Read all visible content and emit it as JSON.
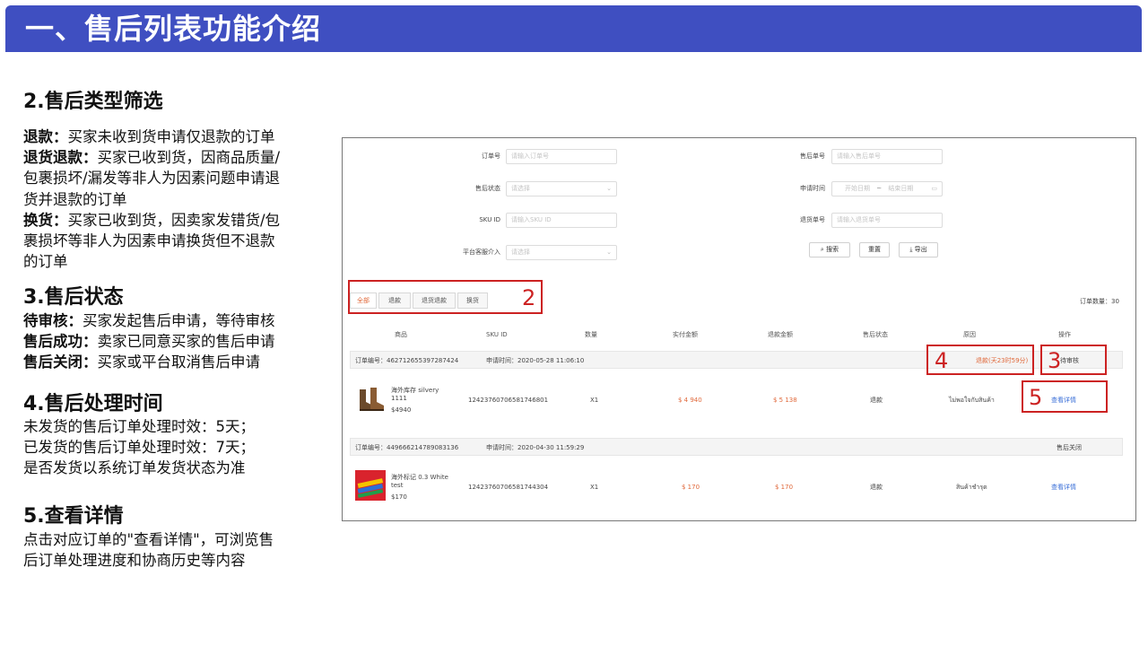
{
  "title": "一、售后列表功能介绍",
  "sections": {
    "s2": {
      "heading": "2.售后类型筛选",
      "items": [
        {
          "key": "退款：",
          "text": [
            "买家未收到货申请仅退款的订单"
          ]
        },
        {
          "key": "退货退款：",
          "text": [
            "买家已收到货，因商品质量/",
            "包裹损坏/漏发等非人为因素问题申请退",
            "货并退款的订单"
          ]
        },
        {
          "key": "换货：",
          "text": [
            "买家已收到货，因卖家发错货/包",
            "裹损坏等非人为因素申请换货但不退款",
            "的订单"
          ]
        }
      ]
    },
    "s3": {
      "heading": "3.售后状态",
      "items": [
        {
          "key": "待审核：",
          "text": "买家发起售后申请，等待审核"
        },
        {
          "key": "售后成功：",
          "text": "卖家已同意买家的售后申请"
        },
        {
          "key": "售后关闭：",
          "text": "买家或平台取消售后申请"
        }
      ]
    },
    "s4": {
      "heading": "4.售后处理时间",
      "lines": [
        "未发货的售后订单处理时效：5天；",
        "已发货的售后订单处理时效：7天；",
        "是否发货以系统订单发货状态为准"
      ]
    },
    "s5": {
      "heading": "5.查看详情",
      "lines": [
        "点击对应订单的\"查看详情\"，可浏览售",
        "后订单处理进度和协商历史等内容"
      ]
    }
  },
  "screenshot": {
    "filters": {
      "order_no": {
        "label": "订单号",
        "placeholder": "请输入订单号"
      },
      "after_sale_no": {
        "label": "售后单号",
        "placeholder": "请输入售后单号"
      },
      "status": {
        "label": "售后状态",
        "placeholder": "请选择"
      },
      "apply_time": {
        "label": "申请时间",
        "start": "开始日期",
        "sep": "~",
        "end": "结束日期"
      },
      "sku": {
        "label": "SKU ID",
        "placeholder": "请输入SKU ID"
      },
      "return_no": {
        "label": "退货单号",
        "placeholder": "请输入退货单号"
      },
      "platform": {
        "label": "平台客服介入",
        "placeholder": "请选择"
      },
      "search_label": "搜索",
      "reset_label": "重置",
      "export_label": "导出"
    },
    "tabs": [
      "全部",
      "退款",
      "退货退款",
      "换货"
    ],
    "order_count": "订单数量：30",
    "columns": [
      "商品",
      "SKU ID",
      "数量",
      "实付金额",
      "退款金额",
      "售后状态",
      "原因",
      "操作"
    ],
    "orders": [
      {
        "order_no": "订单编号：462712655397287424",
        "apply_time": "申请时间：2020-05-28 11:06:10",
        "countdown": "退款(天23时59分)",
        "status_tag": "待审核",
        "product_name": [
          "海外库存 silvery",
          "1111"
        ],
        "product_price": "$4940",
        "sku": "1242376070658174680​1",
        "qty": "X1",
        "paid": "$ 4 940",
        "refund": "$ 5 138",
        "type": "退款",
        "reason": "ไม่พอใจกับสินค้า",
        "action": "查看详情"
      },
      {
        "order_no": "订单编号：449666214789083136",
        "apply_time": "申请时间：2020-04-30 11:59:29",
        "status_tag": "售后关闭",
        "product_name": [
          "海外标记 0.3 White",
          "test"
        ],
        "product_price": "$170",
        "sku": "1242376070658174430​4",
        "qty": "X1",
        "paid": "$ 170",
        "refund": "$ 170",
        "type": "退款",
        "reason": "สินค้าชำรุด",
        "action": "查看详情"
      }
    ],
    "markers": [
      "2",
      "3",
      "4",
      "5"
    ]
  },
  "colors": {
    "title_bg": "#3f4fc1",
    "accent_orange": "#e0683a",
    "link_blue": "#3a6fd8",
    "marker_red": "#cc2222"
  }
}
